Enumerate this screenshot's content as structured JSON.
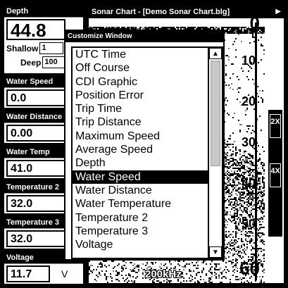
{
  "panels": {
    "depth": {
      "label": "Depth",
      "value": "44.8",
      "shallow_label": "Shallow",
      "shallow_value": "1",
      "deep_label": "Deep",
      "deep_value": "100"
    },
    "water_speed": {
      "label": "Water Speed",
      "value": "0.0"
    },
    "water_distance": {
      "label": "Water Distance",
      "value": "0.00"
    },
    "water_temp": {
      "label": "Water Temp",
      "value": "41.0"
    },
    "temperature2": {
      "label": "Temperature 2",
      "value": "32.0"
    },
    "temperature3": {
      "label": "Temperature 3",
      "value": "32.0"
    },
    "voltage": {
      "label": "Voltage",
      "value": "11.7",
      "unit": "V"
    }
  },
  "chart": {
    "title": "Sonar Chart - [Demo Sonar Chart.blg]",
    "title_arrow": "▶",
    "frequency": "200kHz",
    "depth_labels": [
      "0",
      "10",
      "20",
      "30",
      "40",
      "50",
      "60"
    ],
    "zoom_buttons": [
      "2X",
      "4X"
    ]
  },
  "dialog": {
    "title": "Customize Window",
    "items": [
      "UTC Time",
      "Off Course",
      "CDI Graphic",
      "Position Error",
      "Trip Time",
      "Trip Distance",
      "Maximum Speed",
      "Average Speed",
      "Depth",
      "Water Speed",
      "Water Distance",
      "Water Temperature",
      "Temperature 2",
      "Temperature 3",
      "Voltage"
    ],
    "selected_index": 9,
    "scroll_up": "▲",
    "scroll_down": "▼"
  }
}
